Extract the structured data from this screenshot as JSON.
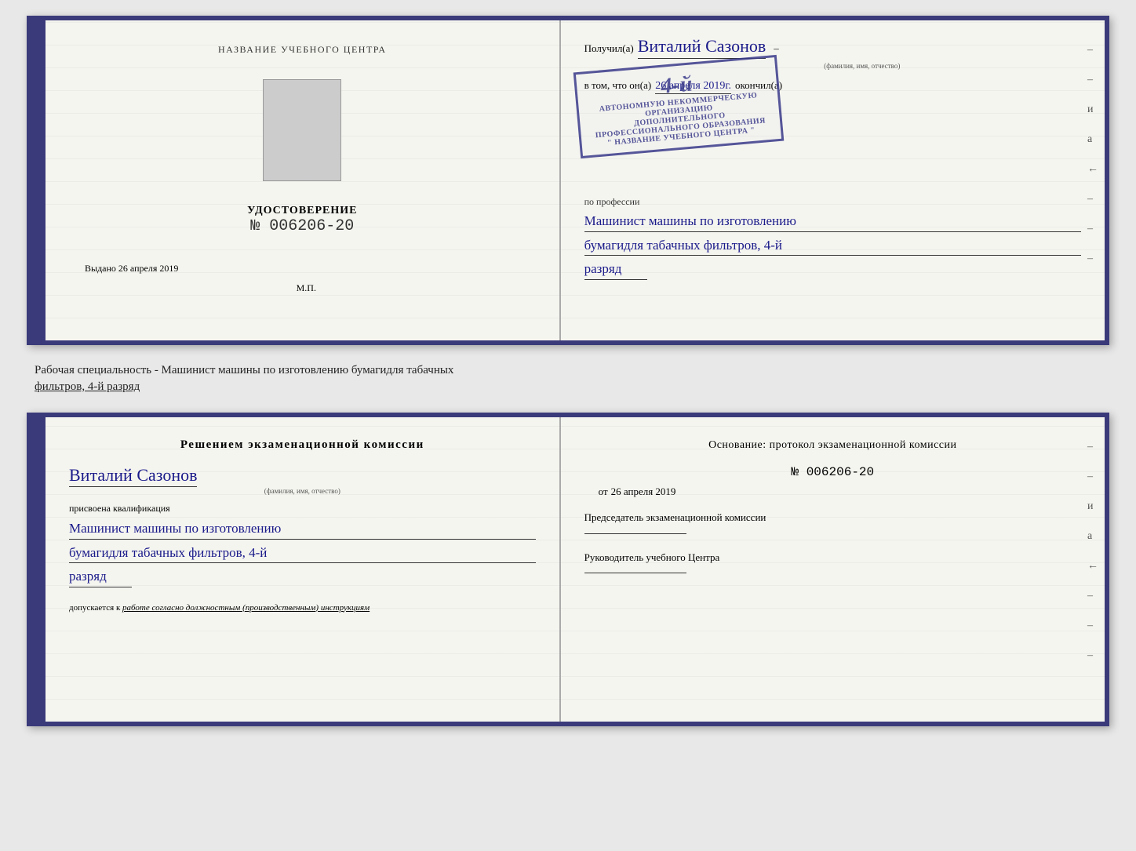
{
  "top_cert": {
    "left": {
      "center_title": "НАЗВАНИЕ УЧЕБНОГО ЦЕНТРА",
      "udostoverenie_label": "УДОСТОВЕРЕНИЕ",
      "number": "№ 006206-20",
      "vydano_label": "Выдано",
      "vydano_date": "26 апреля 2019",
      "mp": "М.П."
    },
    "right": {
      "poluchil_prefix": "Получил(а)",
      "recipient_name": "Виталий Сазонов",
      "recipient_sublabel": "(фамилия, имя, отчество)",
      "dash1": "–",
      "vtom_prefix": "в том, что он(а)",
      "vtom_date": "26 апреля 2019г.",
      "okonchil": "окончил(а)",
      "stamp_line1": "4-й",
      "stamp_line2": "АВТОНОМНУЮ НЕКОММЕРЧЕСКУЮ ОРГАНИЗАЦИЮ",
      "stamp_line3": "ДОПОЛНИТЕЛЬНОГО ПРОФЕССИОНАЛЬНОГО ОБРАЗОВАНИЯ",
      "stamp_line4": "\" НАЗВАНИЕ УЧЕБНОГО ЦЕНТРА \"",
      "i_label": "и",
      "a_label": "а",
      "prof_prefix": "по профессии",
      "profession1": "Машинист машины по изготовлению",
      "profession2": "бумагидля табачных фильтров, 4-й",
      "profession3": "разряд",
      "dashes": [
        "-",
        "-",
        "-",
        "и",
        "а",
        "←",
        "-",
        "-",
        "-",
        "-"
      ]
    }
  },
  "middle": {
    "text": "Рабочая специальность - Машинист машины по изготовлению бумагидля табачных",
    "text2_underline": "фильтров, 4-й разряд"
  },
  "bottom_cert": {
    "left": {
      "title": "Решением  экзаменационной  комиссии",
      "name": "Виталий Сазонов",
      "name_sublabel": "(фамилия, имя, отчество)",
      "prisvoena": "присвоена квалификация",
      "qual1": "Машинист машины по изготовлению",
      "qual2": "бумагидля табачных фильтров, 4-й",
      "qual3": "разряд",
      "допускается_prefix": "допускается к",
      "допускается_text": "работе согласно должностным (производственным) инструкциям"
    },
    "right": {
      "osnov_title": "Основание:  протокол  экзаменационной  комиссии",
      "number": "№  006206-20",
      "ot_prefix": "от",
      "ot_date": "26 апреля 2019",
      "predsedatel": "Председатель экзаменационной комиссии",
      "rukov": "Руководитель учебного Центра",
      "dashes": [
        "-",
        "-",
        "-",
        "и",
        "а",
        "←",
        "-",
        "-",
        "-",
        "-"
      ]
    }
  }
}
